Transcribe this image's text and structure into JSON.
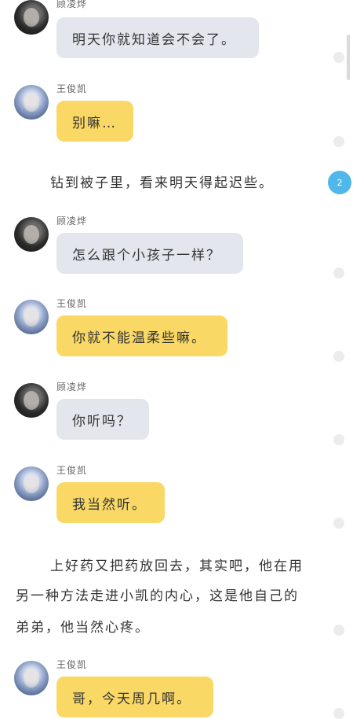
{
  "messages": [
    {
      "speaker": "顾凌烨",
      "text": "明天你就知道会不会了。"
    },
    {
      "speaker": "王俊凯",
      "text": "别嘛…"
    },
    {
      "speaker": "顾凌烨",
      "text": "怎么跟个小孩子一样？"
    },
    {
      "speaker": "王俊凯",
      "text": "你就不能温柔些嘛。"
    },
    {
      "speaker": "顾凌烨",
      "text": "你听吗？"
    },
    {
      "speaker": "王俊凯",
      "text": "我当然听。"
    },
    {
      "speaker": "王俊凯",
      "text": "哥，今天周几啊。"
    }
  ],
  "narration": {
    "line1": "钻到被子里，看来明天得起迟些。",
    "para2_line1": "上好药又把药放回去，其实吧，他在用",
    "para2_line2": "另一种方法走进小凯的内心，这是他自己的",
    "para2_line3": "弟弟，他当然心疼。"
  },
  "side_badge": "2",
  "colors": {
    "gray_bubble": "#e3e7ed",
    "yellow_bubble": "#f9d865",
    "badge": "#4fb7e9"
  }
}
